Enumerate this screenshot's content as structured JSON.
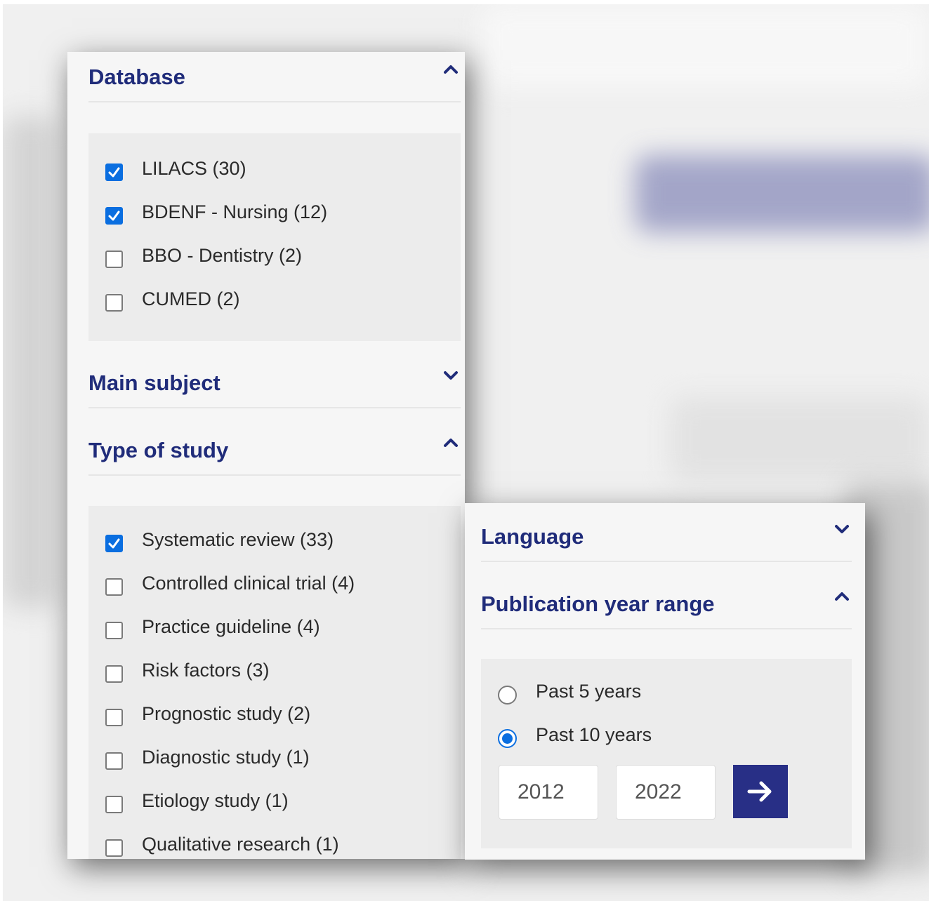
{
  "filters_left": {
    "database": {
      "title": "Database",
      "expanded": true,
      "options": [
        {
          "label": "LILACS (30)",
          "checked": true
        },
        {
          "label": "BDENF - Nursing (12)",
          "checked": true
        },
        {
          "label": "BBO - Dentistry (2)",
          "checked": false
        },
        {
          "label": "CUMED (2)",
          "checked": false
        }
      ]
    },
    "main_subject": {
      "title": "Main subject",
      "expanded": false
    },
    "type_of_study": {
      "title": "Type of study",
      "expanded": true,
      "options": [
        {
          "label": "Systematic review (33)",
          "checked": true
        },
        {
          "label": "Controlled clinical trial (4)",
          "checked": false
        },
        {
          "label": "Practice guideline (4)",
          "checked": false
        },
        {
          "label": "Risk factors (3)",
          "checked": false
        },
        {
          "label": "Prognostic study (2)",
          "checked": false
        },
        {
          "label": "Diagnostic study (1)",
          "checked": false
        },
        {
          "label": "Etiology study (1)",
          "checked": false
        },
        {
          "label": "Qualitative research (1)",
          "checked": false
        }
      ]
    }
  },
  "filters_right": {
    "language": {
      "title": "Language",
      "expanded": false
    },
    "publication_year_range": {
      "title": "Publication year range",
      "expanded": true,
      "options": [
        {
          "label": "Past 5 years",
          "selected": false
        },
        {
          "label": "Past 10 years",
          "selected": true
        }
      ],
      "from_year": "2012",
      "to_year": "2022"
    }
  },
  "colors": {
    "heading": "#202c7a",
    "checked": "#0a6ee0",
    "apply_button": "#282f86"
  }
}
